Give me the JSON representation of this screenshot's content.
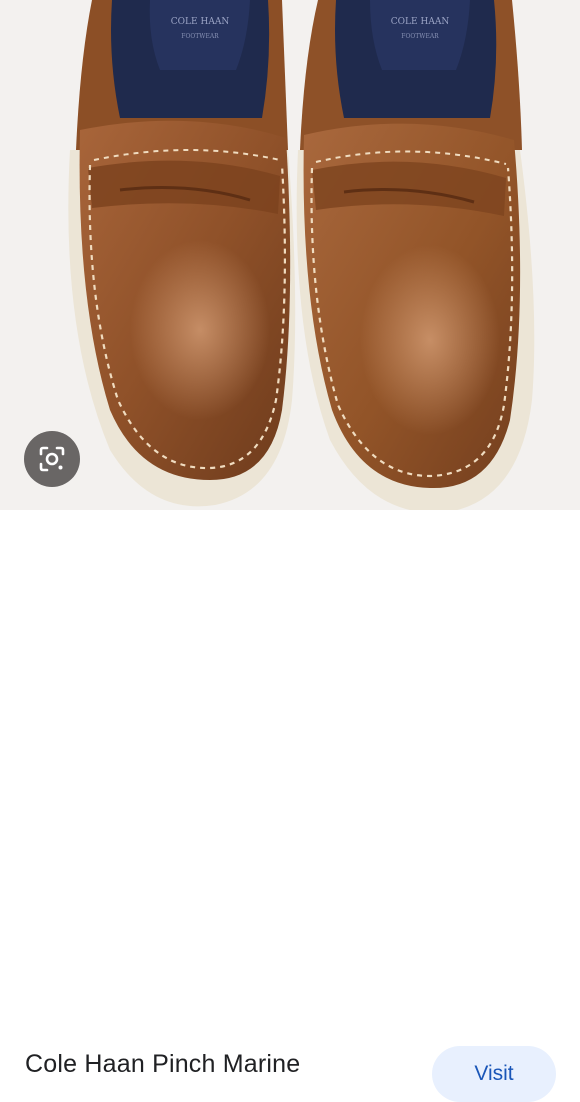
{
  "product": {
    "title": "Cole Haan Pinch Marine",
    "image_alt": "Brown leather penny loafers",
    "insole_brand_text": "COLE HAAN"
  },
  "actions": {
    "visit_label": "Visit",
    "lens_icon": "lens-search-icon"
  },
  "colors": {
    "leather": "#9a5a2e",
    "insole": "#1f2a4d",
    "accent_button_bg": "#e8f0fe",
    "accent_button_text": "#1a56b8"
  }
}
